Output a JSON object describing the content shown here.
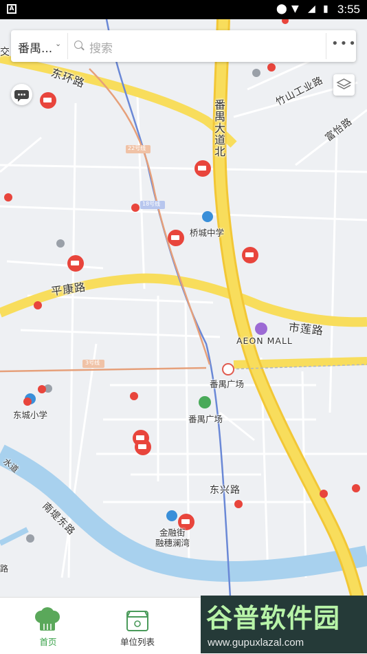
{
  "status_bar": {
    "time": "3:55"
  },
  "search": {
    "district": "番禺...",
    "placeholder": "搜索",
    "more": "•••"
  },
  "map_labels": {
    "dong_huan_lu": "东环路",
    "panyu_dadao_bei": "番禺大道北",
    "zhushan_gongye_lu": "竹山工业路",
    "fuyi_lu": "富怡路",
    "line22": "22号线",
    "line18": "18号线",
    "line3": "3号线",
    "qiaocheng_zhongxue": "桥城中学",
    "pingkang_lu": "平康路",
    "shilian_lu": "市莲路",
    "aeon_mall": "AEON MALL",
    "panyu_guangchang_station": "番禺广场",
    "panyu_guangchang": "番禺广场",
    "dongcheng_xiaoxue": "东城小学",
    "dongxing_lu": "东兴路",
    "nanti_donglu": "南堤东路",
    "jinrongjie": "金融街",
    "rongsui_lanwan": "融穗澜湾",
    "jiao_partial": "交",
    "shuidao": "水道",
    "bottom_lu": "路"
  },
  "tabs": [
    {
      "label": "首页",
      "icon": "chef-hat-icon",
      "active": true
    },
    {
      "label": "单位列表",
      "icon": "shop-list-icon",
      "active": false
    },
    {
      "label": "",
      "icon": "",
      "active": false
    },
    {
      "label": "",
      "icon": "",
      "active": false
    }
  ],
  "watermark": {
    "title": "谷普软件园",
    "url": "www.gupuxlazal.com"
  },
  "colors": {
    "major_road": "#f8dd5c",
    "main_artery": "#f2c736",
    "river": "#a8d1ee",
    "camera_marker": "#e8453c",
    "metro_line22": "#e6a07a",
    "metro_line18": "#6a88d6",
    "metro_line3": "#e6a07a",
    "tab_active": "#3aa24a"
  }
}
